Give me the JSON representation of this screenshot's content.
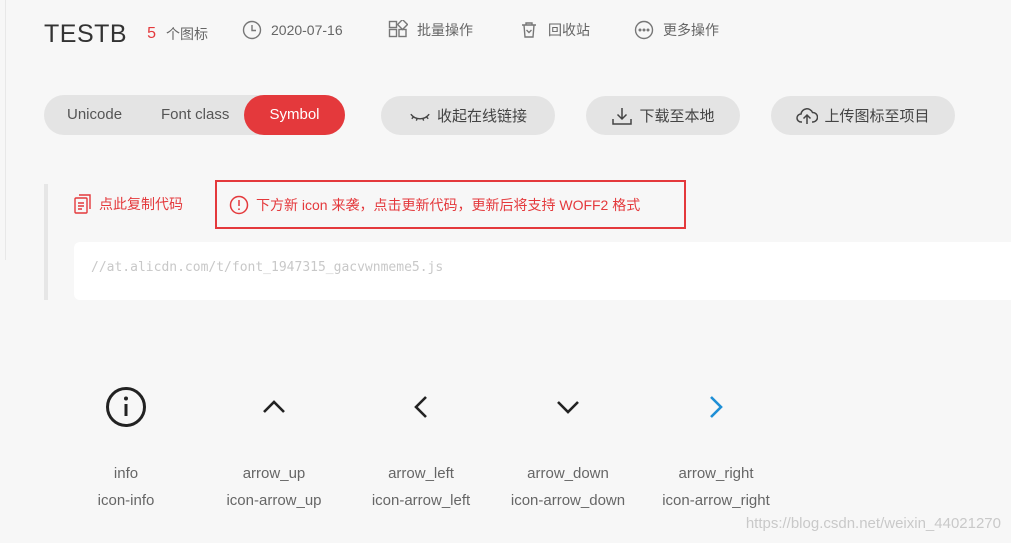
{
  "header": {
    "title": "TESTB",
    "count": "5",
    "count_label": "个图标",
    "date": "2020-07-16",
    "batch_label": "批量操作",
    "recycle_label": "回收站",
    "more_label": "更多操作"
  },
  "toolbar": {
    "tabs": [
      {
        "label": "Unicode",
        "active": false
      },
      {
        "label": "Font class",
        "active": false
      },
      {
        "label": "Symbol",
        "active": true
      }
    ],
    "collapse_label": "收起在线链接",
    "download_label": "下载至本地",
    "upload_label": "上传图标至项目"
  },
  "code_panel": {
    "copy_label": "点此复制代码",
    "notice": "下方新 icon 来袭，点击更新代码，更新后将支持 WOFF2 格式",
    "code": "//at.alicdn.com/t/font_1947315_gacvwnmeme5.js"
  },
  "icons": [
    {
      "name": "info",
      "class_name": "icon-info",
      "glyph": "info-circle-icon",
      "color": "#222222"
    },
    {
      "name": "arrow_up",
      "class_name": "icon-arrow_up",
      "glyph": "arrow-up-icon",
      "color": "#222222"
    },
    {
      "name": "arrow_left",
      "class_name": "icon-arrow_left",
      "glyph": "arrow-left-icon",
      "color": "#222222"
    },
    {
      "name": "arrow_down",
      "class_name": "icon-arrow_down",
      "glyph": "arrow-down-icon",
      "color": "#222222"
    },
    {
      "name": "arrow_right",
      "class_name": "icon-arrow_right",
      "glyph": "arrow-right-icon",
      "color": "#1e8fd6"
    }
  ],
  "colors": {
    "accent": "#e4393c",
    "hover_blue": "#1e8fd6"
  },
  "watermark": "https://blog.csdn.net/weixin_44021270"
}
